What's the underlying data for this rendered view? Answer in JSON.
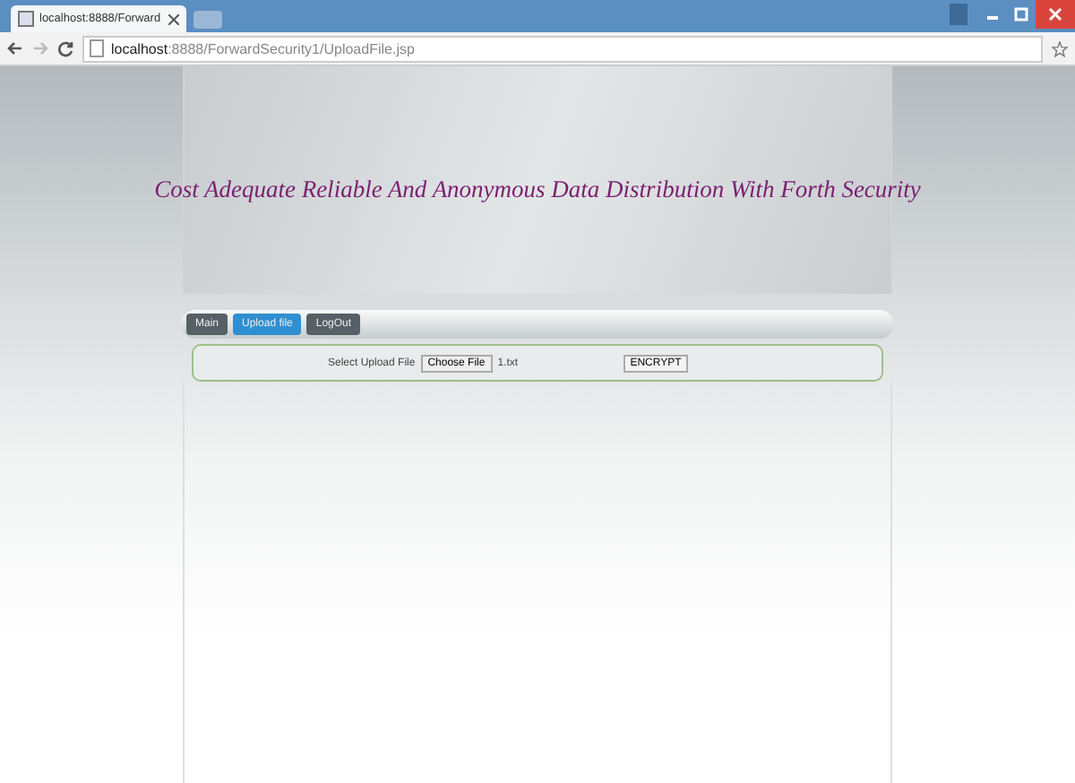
{
  "browser": {
    "tab_title": "localhost:8888/Forward",
    "url_host": "localhost",
    "url_rest": ":8888/ForwardSecurity1/UploadFile.jsp"
  },
  "page": {
    "title": "Cost Adequate Reliable And Anonymous Data Distribution With Forth Security",
    "nav": [
      {
        "label": "Main",
        "selected": false
      },
      {
        "label": "Upload file",
        "selected": true
      },
      {
        "label": "LogOut",
        "selected": false
      }
    ],
    "form": {
      "label": "Select Upload File",
      "choose_button": "Choose File",
      "file_name": "1.txt",
      "submit": "ENCRYPT"
    }
  }
}
